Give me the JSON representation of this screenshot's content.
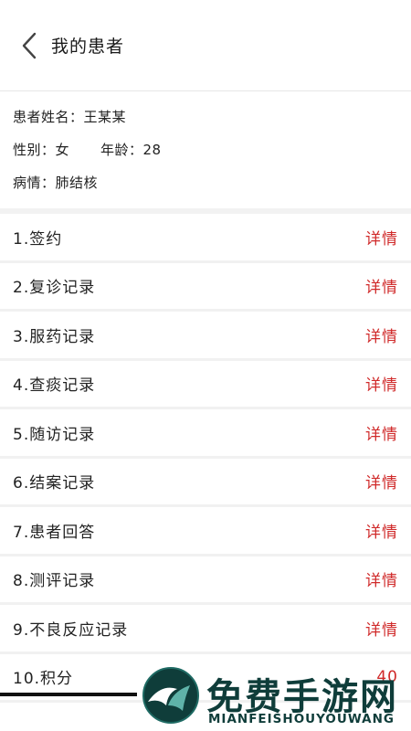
{
  "header": {
    "title": "我的患者",
    "back_icon": "chevron-left-icon"
  },
  "patient": {
    "name_line": "患者姓名：王某某",
    "gender_line": "性别：女",
    "age_line": "年龄：28",
    "condition_line": "病情：肺结核"
  },
  "records": [
    {
      "label": "1.签约",
      "action": "详情"
    },
    {
      "label": "2.复诊记录",
      "action": "详情"
    },
    {
      "label": "3.服药记录",
      "action": "详情"
    },
    {
      "label": "4.查痰记录",
      "action": "详情"
    },
    {
      "label": "5.随访记录",
      "action": "详情"
    },
    {
      "label": "6.结案记录",
      "action": "详情"
    },
    {
      "label": "7.患者回答",
      "action": "详情"
    },
    {
      "label": "8.测评记录",
      "action": "详情"
    },
    {
      "label": "9.不良反应记录",
      "action": "详情"
    },
    {
      "label": "10.积分",
      "action": "40"
    }
  ],
  "watermark": {
    "title": "免费手游网",
    "subtitle": "MIANFEISHOUYOUWANG"
  },
  "colors": {
    "accent_red": "#d02a2a",
    "watermark_green": "#0f3d3a"
  }
}
